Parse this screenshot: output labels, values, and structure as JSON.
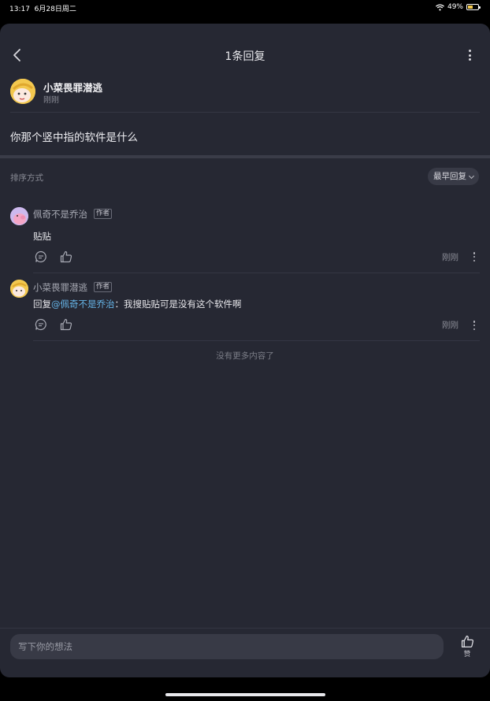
{
  "status_bar": {
    "time": "13:17",
    "date": "6月28日周二",
    "battery_percent": "49%",
    "battery_level": 0.49
  },
  "header": {
    "title": "1条回复"
  },
  "original_post": {
    "author": "小菜畏罪潜逃",
    "time": "刚刚",
    "content": "你那个竖中指的软件是什么"
  },
  "sort": {
    "label": "排序方式",
    "selected": "最早回复"
  },
  "comments": [
    {
      "author": "佩奇不是乔治",
      "tag": "作者",
      "prefix": "",
      "mention": "",
      "separator": "",
      "text": "贴贴",
      "time": "刚刚"
    },
    {
      "author": "小菜畏罪潜逃",
      "tag": "作者",
      "prefix": "回复",
      "mention": "@佩奇不是乔治",
      "separator": "：",
      "text": "我搜贴贴可是没有这个软件啊",
      "time": "刚刚"
    }
  ],
  "footer_note": "没有更多内容了",
  "bottom_bar": {
    "placeholder": "写下你的想法",
    "like_label": "赞"
  },
  "colors": {
    "background": "#262833",
    "accent_mention": "#66b5e8",
    "battery": "#f2c94c"
  }
}
